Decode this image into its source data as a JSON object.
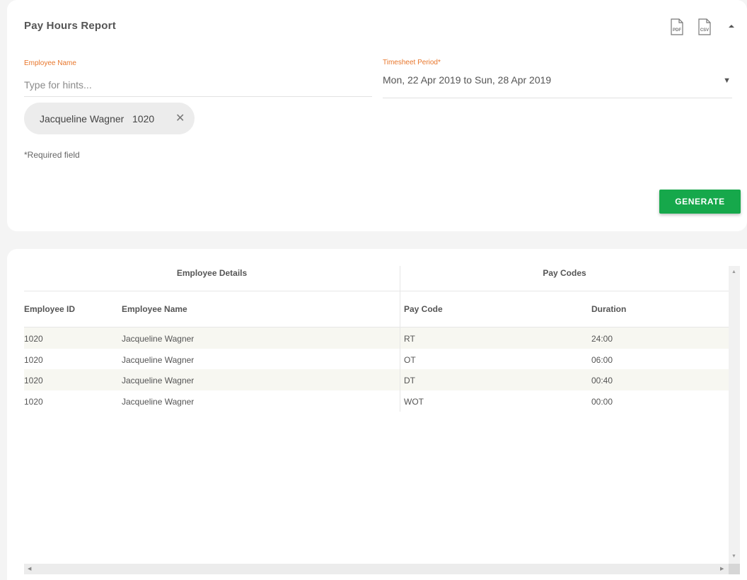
{
  "report": {
    "title": "Pay Hours Report",
    "pdf_icon": "pdf-file-icon",
    "csv_icon": "csv-file-icon",
    "pdf_label": "PDF",
    "csv_label": "CSV",
    "collapse_icon": "triangle-up-icon"
  },
  "form": {
    "employee_label": "Employee Name",
    "employee_placeholder": "Type for hints...",
    "period_label": "Timesheet Period",
    "period_required_mark": "*",
    "period_value": "Mon, 22 Apr 2019 to Sun, 28 Apr 2019",
    "period_arrow": "▼",
    "chip": {
      "name": "Jacqueline Wagner",
      "id": "1020",
      "remove": "✕"
    },
    "required_note": "*Required field",
    "generate_label": "GENERATE"
  },
  "table": {
    "groups": {
      "details": "Employee Details",
      "paycodes": "Pay Codes"
    },
    "columns": {
      "employee_id": "Employee ID",
      "employee_name": "Employee Name",
      "pay_code": "Pay Code",
      "duration": "Duration"
    },
    "rows": [
      {
        "id": "1020",
        "name": "Jacqueline Wagner",
        "code": "RT",
        "duration": "24:00"
      },
      {
        "id": "1020",
        "name": "Jacqueline Wagner",
        "code": "OT",
        "duration": "06:00"
      },
      {
        "id": "1020",
        "name": "Jacqueline Wagner",
        "code": "DT",
        "duration": "00:40"
      },
      {
        "id": "1020",
        "name": "Jacqueline Wagner",
        "code": "WOT",
        "duration": "00:00"
      }
    ]
  },
  "colors": {
    "accent": "#e8762b",
    "primary_button": "#16a84b",
    "alt_row": "#f7f7f1"
  }
}
